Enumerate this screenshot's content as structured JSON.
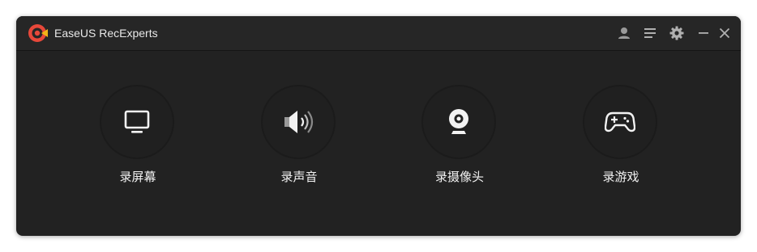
{
  "app": {
    "title": "EaseUS RecExperts",
    "accent_color": "#e8483a",
    "logo_icon": "record-logo-icon"
  },
  "titlebar": {
    "buttons": [
      {
        "name": "account",
        "icon": "user-icon"
      },
      {
        "name": "menu",
        "icon": "menu-icon"
      },
      {
        "name": "settings",
        "icon": "gear-icon"
      },
      {
        "name": "minimize",
        "icon": "minimize-icon"
      },
      {
        "name": "close",
        "icon": "close-icon"
      }
    ]
  },
  "modes": [
    {
      "id": "screen",
      "label": "录屏幕",
      "icon": "monitor-icon"
    },
    {
      "id": "audio",
      "label": "录声音",
      "icon": "speaker-icon"
    },
    {
      "id": "webcam",
      "label": "录摄像头",
      "icon": "webcam-icon"
    },
    {
      "id": "game",
      "label": "录游戏",
      "icon": "gamepad-icon"
    }
  ]
}
